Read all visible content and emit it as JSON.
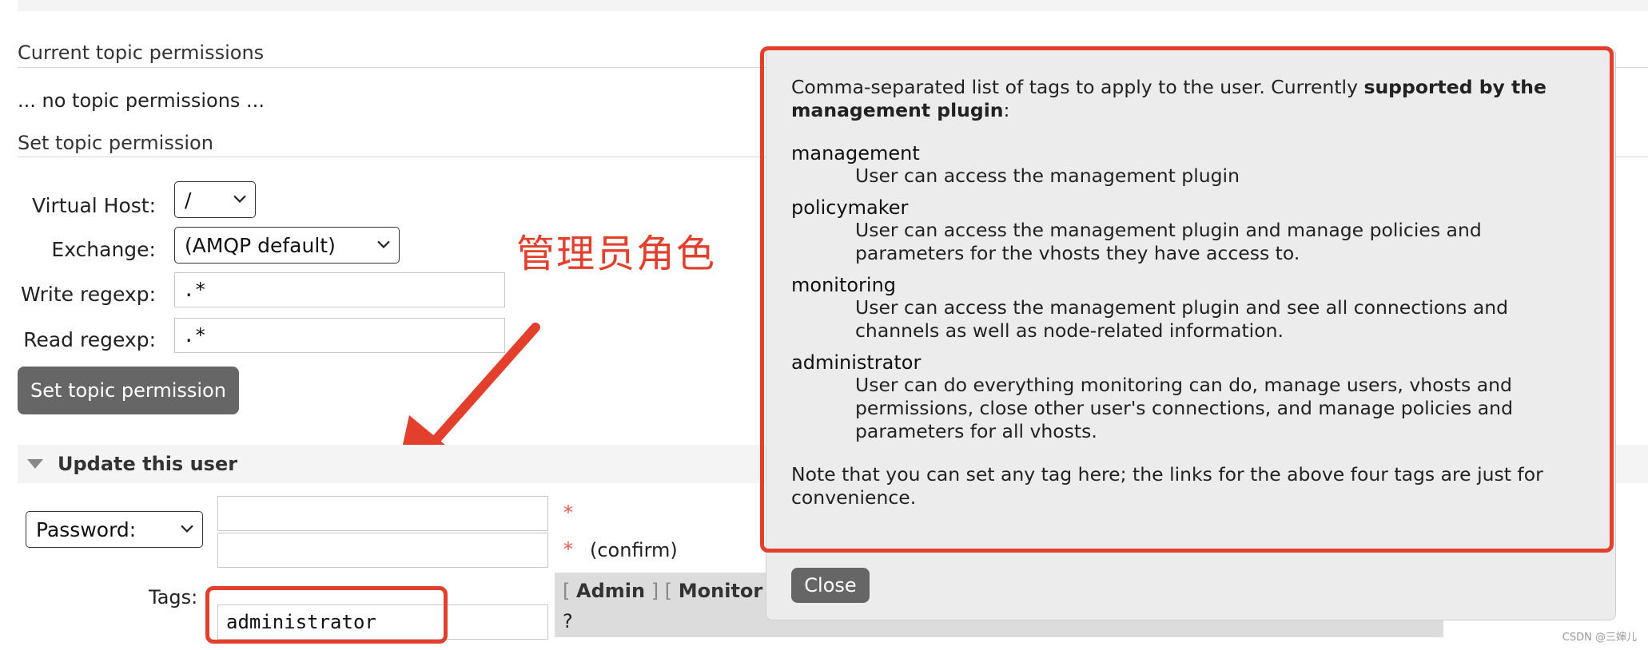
{
  "current_topic_permissions": {
    "heading": "Current topic permissions",
    "empty_text": "... no topic permissions ..."
  },
  "set_topic_permission": {
    "heading": "Set topic permission",
    "virtual_host_label": "Virtual Host:",
    "virtual_host_value": "/",
    "exchange_label": "Exchange:",
    "exchange_value": "(AMQP default)",
    "write_regexp_label": "Write regexp:",
    "write_regexp_value": ".*",
    "read_regexp_label": "Read regexp:",
    "read_regexp_value": ".*",
    "submit_label": "Set topic permission"
  },
  "update_user": {
    "heading": "Update this user",
    "password_select_value": "Password:",
    "required_mark": "*",
    "confirm_label": "(confirm)",
    "tags_label": "Tags:",
    "tags_value": "administrator",
    "tag_links": [
      "Admin",
      "Monitor"
    ],
    "open_bracket": "[",
    "close_bracket": "]",
    "help_marker": "?"
  },
  "annotation": {
    "text": "管理员角色",
    "color": "#e2402d"
  },
  "help_popup": {
    "intro_plain": "Comma-separated list of tags to apply to the user. Currently ",
    "intro_bold": "supported by the management plugin",
    "intro_end": ":",
    "tags": [
      {
        "name": "management",
        "lines": [
          "User can access the management plugin"
        ]
      },
      {
        "name": "policymaker",
        "lines": [
          "User can access the management plugin and manage policies and",
          "parameters for the vhosts they have access to."
        ]
      },
      {
        "name": "monitoring",
        "lines": [
          "User can access the management plugin and see all connections and",
          "channels as well as node-related information."
        ]
      },
      {
        "name": "administrator",
        "lines": [
          "User can do everything monitoring can do, manage users, vhosts and",
          "permissions, close other user's connections, and manage policies and",
          "parameters for all vhosts."
        ]
      }
    ],
    "note_lines": [
      "Note that you can set any tag here; the links for the above four tags are just for",
      "convenience."
    ],
    "close_label": "Close"
  },
  "watermark": "CSDN @三婶儿",
  "colors": {
    "highlight_red": "#e2402d",
    "button_gray": "#666666",
    "popup_bg": "#ececec"
  }
}
